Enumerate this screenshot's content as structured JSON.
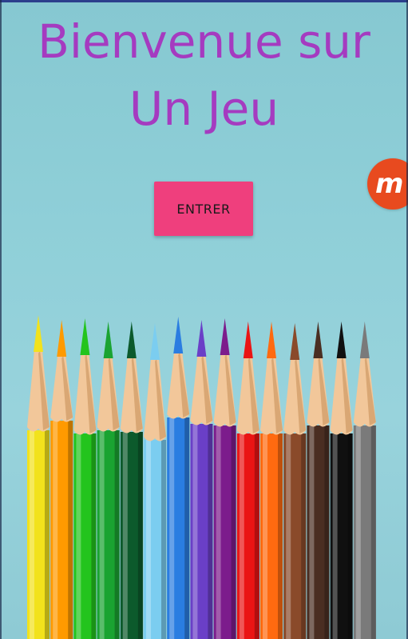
{
  "title": {
    "line1": "Bienvenue sur",
    "line2": "Un Jeu"
  },
  "actions": {
    "enter_label": "ENTRER"
  },
  "badge": {
    "glyph": "m",
    "icon": "mobizen-record-icon"
  },
  "theme": {
    "title_color": "#a53bc0",
    "button_color": "#ef3f7d",
    "background_color": "#8fcfd8",
    "badge_color": "#e84a1f"
  },
  "pencils": {
    "colors": [
      "#f2e21c",
      "#ff9a00",
      "#23c41d",
      "#1aa331",
      "#0c5a2c",
      "#7bcdf0",
      "#2a7de1",
      "#6a3fc7",
      "#7c1c8c",
      "#ea1414",
      "#ff6a10",
      "#8a4a2a",
      "#4a2e22",
      "#101010",
      "#7a7a7a"
    ]
  }
}
